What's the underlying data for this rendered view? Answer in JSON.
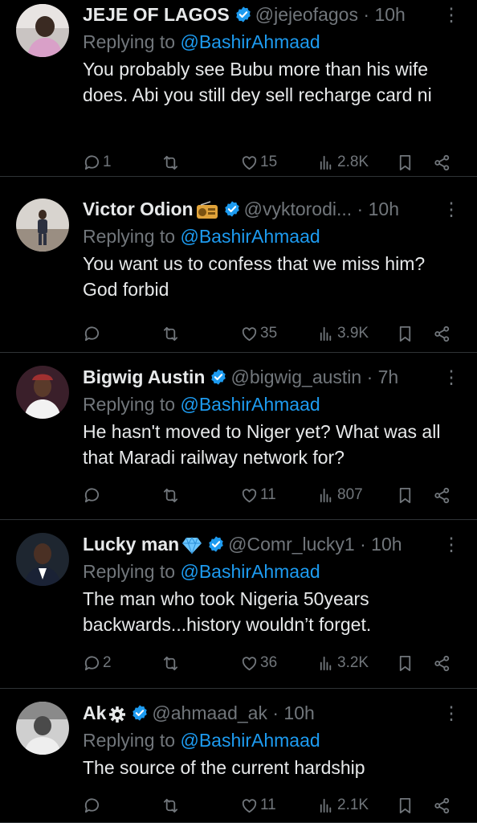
{
  "tweets": [
    {
      "name": "JEJE OF LAGOS",
      "emoji": "",
      "handle": "@jejeofagos",
      "time": "10h",
      "replying_prefix": "Replying to ",
      "replying_to": "@BashirAhmaad",
      "text": "You probably see Bubu more than his wife does. Abi you still dey sell recharge card ni",
      "replies": "1",
      "retweets": "",
      "likes": "15",
      "views": "2.8K"
    },
    {
      "name": "Victor Odion",
      "emoji": "radio",
      "handle": "@vyktorodi...",
      "time": "10h",
      "replying_prefix": "Replying to ",
      "replying_to": "@BashirAhmaad",
      "text": "You want us to confess that we miss him? God forbid",
      "replies": "",
      "retweets": "",
      "likes": "35",
      "views": "3.9K"
    },
    {
      "name": "Bigwig Austin",
      "emoji": "",
      "handle": "@bigwig_austin",
      "time": "7h",
      "replying_prefix": "Replying to ",
      "replying_to": "@BashirAhmaad",
      "text": "He hasn't moved to Niger yet? What was all that Maradi railway network for?",
      "replies": "",
      "retweets": "",
      "likes": "11",
      "views": "807"
    },
    {
      "name": "Lucky man",
      "emoji": "gem",
      "handle": "@Comr_lucky1",
      "time": "10h",
      "replying_prefix": "Replying to ",
      "replying_to": "@BashirAhmaad",
      "text": "The man who took Nigeria 50years backwards...history wouldn’t forget.",
      "replies": "2",
      "retweets": "",
      "likes": "36",
      "views": "3.2K"
    },
    {
      "name": "Ak",
      "emoji": "gear",
      "handle": "@ahmaad_ak",
      "time": "10h",
      "replying_prefix": "Replying to ",
      "replying_to": "@BashirAhmaad",
      "text": "The source of the current hardship",
      "replies": "",
      "retweets": "",
      "likes": "11",
      "views": "2.1K"
    }
  ],
  "colors": {
    "background": "#000000",
    "text": "#e7e9ea",
    "secondary": "#71767b",
    "accent": "#1d9bf0",
    "verified": "#1d9bf0",
    "divider": "#2f3336"
  }
}
